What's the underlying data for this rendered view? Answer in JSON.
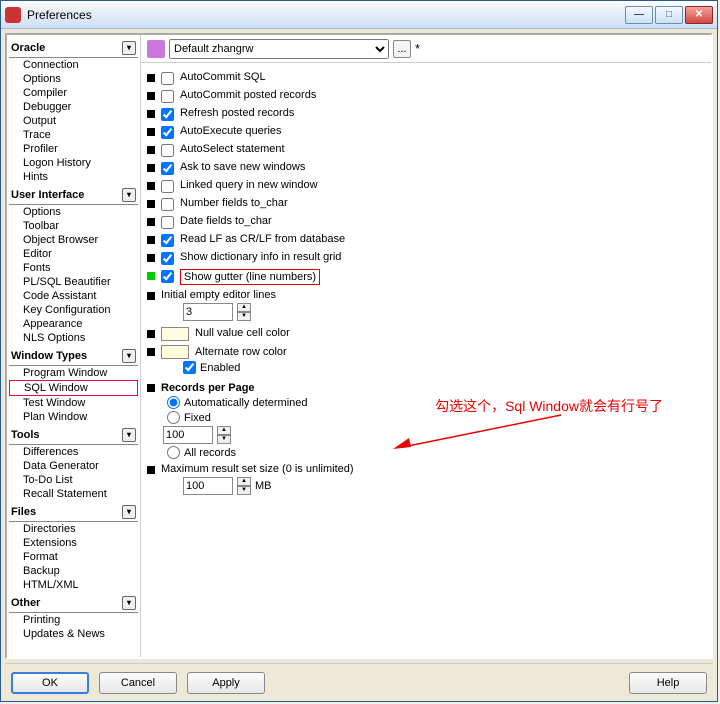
{
  "window": {
    "title": "Preferences"
  },
  "preset": {
    "selected": "Default zhangrw",
    "ellipsis": "...",
    "dirty": "*"
  },
  "sidebar": {
    "categories": [
      {
        "label": "Oracle",
        "items": [
          "Connection",
          "Options",
          "Compiler",
          "Debugger",
          "Output",
          "Trace",
          "Profiler",
          "Logon History",
          "Hints"
        ]
      },
      {
        "label": "User Interface",
        "items": [
          "Options",
          "Toolbar",
          "Object Browser",
          "Editor",
          "Fonts",
          "PL/SQL Beautifier",
          "Code Assistant",
          "Key Configuration",
          "Appearance",
          "NLS Options"
        ]
      },
      {
        "label": "Window Types",
        "items": [
          "Program Window",
          "SQL Window",
          "Test Window",
          "Plan Window"
        ],
        "selected": 1
      },
      {
        "label": "Tools",
        "items": [
          "Differences",
          "Data Generator",
          "To-Do List",
          "Recall Statement"
        ]
      },
      {
        "label": "Files",
        "items": [
          "Directories",
          "Extensions",
          "Format",
          "Backup",
          "HTML/XML"
        ]
      },
      {
        "label": "Other",
        "items": [
          "Printing",
          "Updates & News"
        ]
      }
    ]
  },
  "settings": {
    "checks": [
      {
        "label": "AutoCommit SQL",
        "checked": false
      },
      {
        "label": "AutoCommit posted records",
        "checked": false
      },
      {
        "label": "Refresh posted records",
        "checked": true
      },
      {
        "label": "AutoExecute queries",
        "checked": true
      },
      {
        "label": "AutoSelect statement",
        "checked": false
      },
      {
        "label": "Ask to save new windows",
        "checked": true
      },
      {
        "label": "Linked query in new window",
        "checked": false
      },
      {
        "label": "Number fields to_char",
        "checked": false
      },
      {
        "label": "Date fields to_char",
        "checked": false
      },
      {
        "label": "Read LF as CR/LF from database",
        "checked": true
      },
      {
        "label": "Show dictionary info in result grid",
        "checked": true
      },
      {
        "label": "Show gutter (line numbers)",
        "checked": true,
        "highlight": true
      }
    ],
    "initial_lines": {
      "label": "Initial empty editor lines",
      "value": "3"
    },
    "null_color": {
      "label": "Null value cell color"
    },
    "alt_row": {
      "label": "Alternate row color",
      "enabled_label": "Enabled",
      "enabled": true
    },
    "records": {
      "header": "Records per Page",
      "auto": "Automatically determined",
      "fixed": "Fixed",
      "fixed_value": "100",
      "all": "All records",
      "mode": "auto"
    },
    "maxresult": {
      "label": "Maximum result set size (0 is unlimited)",
      "value": "100",
      "unit": "MB"
    },
    "annotation": "勾选这个，Sql Window就会有行号了"
  },
  "buttons": {
    "ok": "OK",
    "cancel": "Cancel",
    "apply": "Apply",
    "help": "Help"
  }
}
